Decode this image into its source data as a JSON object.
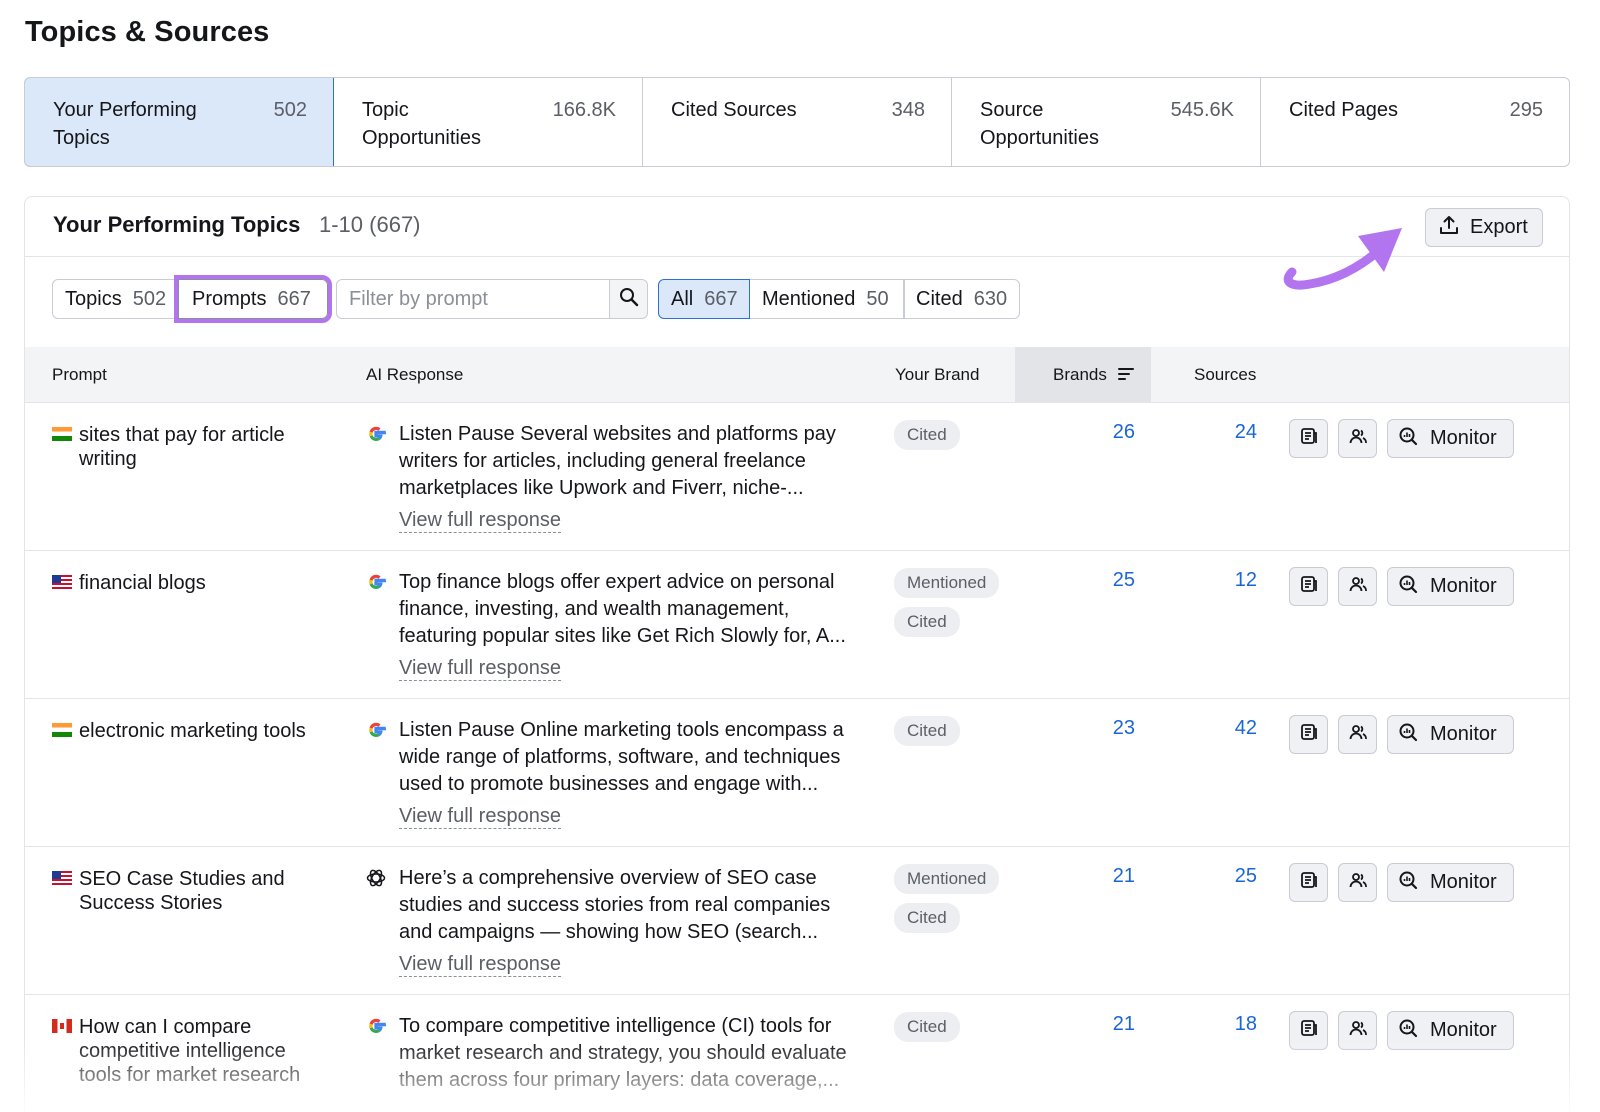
{
  "page_title": "Topics & Sources",
  "tabs": [
    {
      "label": "Your Performing Topics",
      "count": "502",
      "active": true
    },
    {
      "label": "Topic Opportunities",
      "count": "166.8K"
    },
    {
      "label": "Cited Sources",
      "count": "348"
    },
    {
      "label": "Source Opportunities",
      "count": "545.6K"
    },
    {
      "label": "Cited Pages",
      "count": "295"
    }
  ],
  "section": {
    "title": "Your Performing Topics",
    "range": "1-10 (667)",
    "export_label": "Export"
  },
  "filters": {
    "topics_label": "Topics",
    "topics_count": "502",
    "prompts_label": "Prompts",
    "prompts_count": "667",
    "search_placeholder": "Filter by prompt",
    "all_label": "All",
    "all_count": "667",
    "mentioned_label": "Mentioned",
    "mentioned_count": "50",
    "cited_label": "Cited",
    "cited_count": "630"
  },
  "table": {
    "headers": {
      "prompt": "Prompt",
      "ai_response": "AI Response",
      "your_brand": "Your Brand",
      "brands": "Brands",
      "sources": "Sources"
    },
    "view_full_label": "View full response",
    "monitor_label": "Monitor",
    "rows": [
      {
        "flag": "india-flag-icon",
        "prompt": "sites that pay for article writing",
        "ai_engine": "google-icon",
        "response": "Listen Pause Several websites and platforms pay writers for articles, including general freelance marketplaces like Upwork and Fiverr, niche-...",
        "badges": [
          "Cited"
        ],
        "brands": "26",
        "sources": "24"
      },
      {
        "flag": "usa-flag-icon",
        "prompt": "financial blogs",
        "ai_engine": "google-icon",
        "response": "Top finance blogs offer expert advice on personal finance, investing, and wealth management, featuring popular sites like Get Rich Slowly for, A...",
        "badges": [
          "Mentioned",
          "Cited"
        ],
        "brands": "25",
        "sources": "12"
      },
      {
        "flag": "india-flag-icon",
        "prompt": "electronic marketing tools",
        "ai_engine": "google-icon",
        "response": "Listen Pause Online marketing tools encompass a wide range of platforms, software, and techniques used to promote businesses and engage with...",
        "badges": [
          "Cited"
        ],
        "brands": "23",
        "sources": "42"
      },
      {
        "flag": "usa-flag-icon",
        "prompt": "SEO Case Studies and Success Stories",
        "ai_engine": "chatgpt-icon",
        "response": "Here’s a comprehensive overview of SEO case studies and success stories from real companies and campaigns — showing how SEO (search...",
        "badges": [
          "Mentioned",
          "Cited"
        ],
        "brands": "21",
        "sources": "25"
      },
      {
        "flag": "canada-flag-icon",
        "prompt": "How can I compare competitive intelligence tools for market research",
        "ai_engine": "google-icon",
        "response": "To compare competitive intelligence (CI) tools for market research and strategy, you should evaluate them across four primary layers: data coverage,...",
        "badges": [
          "Cited"
        ],
        "brands": "21",
        "sources": "18"
      }
    ]
  },
  "colors": {
    "accent": "#2f6fd1",
    "link": "#1a66d4",
    "highlight": "#b374ef",
    "active_bg": "#dbe8fa"
  }
}
